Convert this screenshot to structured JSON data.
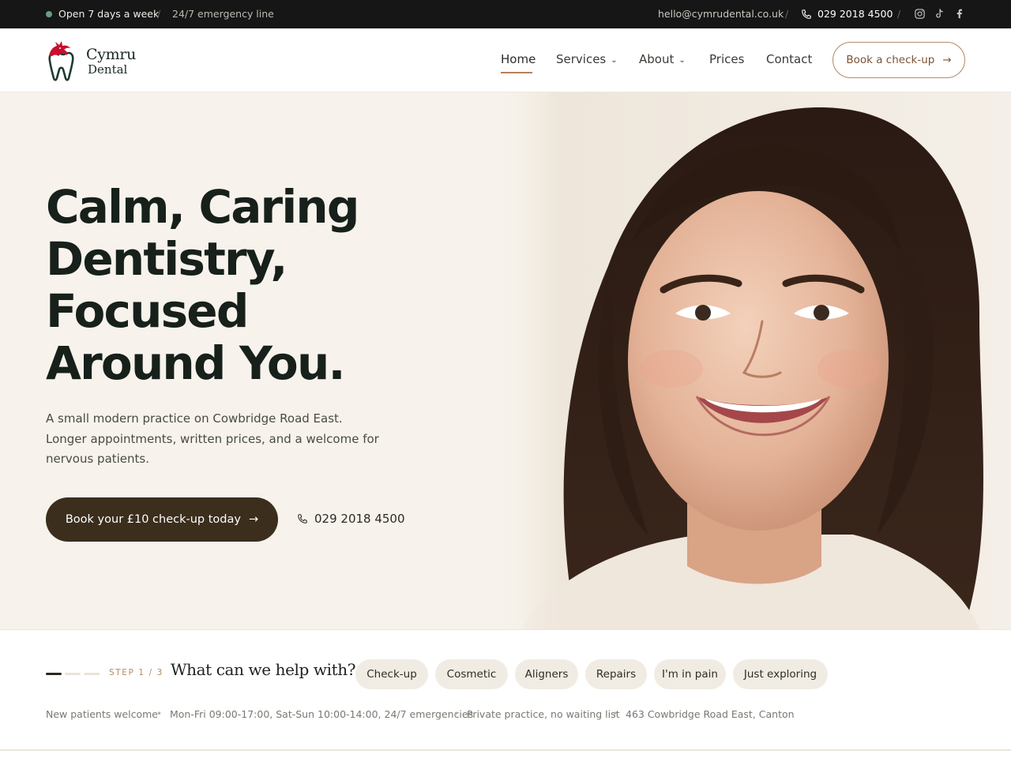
{
  "topbar": {
    "open_text": "Open 7 days a week",
    "emergency_text": "24/7 emergency line",
    "email": "hello@cymrudental.co.uk",
    "phone": "029 2018 4500",
    "separator": "/",
    "socials": [
      "instagram-icon",
      "tiktok-icon",
      "facebook-icon"
    ],
    "status_color": "#6c9c7e"
  },
  "header": {
    "logo_line1": "Cymru",
    "logo_line2": "Dental",
    "nav": [
      {
        "label": "Home",
        "active": true
      },
      {
        "label": "Services",
        "dropdown": true
      },
      {
        "label": "About",
        "dropdown": true
      },
      {
        "label": "Prices"
      },
      {
        "label": "Contact"
      }
    ],
    "book_label": "Book a check-up",
    "chevron": "⌄",
    "arrow": "→"
  },
  "hero": {
    "title_lines": [
      "Calm, Caring",
      "Dentistry,",
      "Focused",
      "Around You."
    ],
    "subtitle": "A small modern practice on Cowbridge Road East. Longer appointments, written prices, and a welcome for nervous patients.",
    "cta_label": "Book your £10 check-up today",
    "phone": "029 2018 4500",
    "cta_color": "#3b2e1c",
    "background_color": "#f7f3ec"
  },
  "helper": {
    "step_label": "STEP 1 / 3",
    "question": "What can we help with?",
    "options": [
      "Check-up",
      "Cosmetic",
      "Aligners",
      "Repairs",
      "I'm in pain",
      "Just exploring"
    ]
  },
  "info_bar": {
    "items": [
      "New patients welcome",
      "Mon-Fri 09:00-17:00, Sat-Sun 10:00-14:00, 24/7 emergencies",
      "Private practice, no waiting list",
      "463 Cowbridge Road East, Canton"
    ],
    "bullet": "•"
  },
  "colors": {
    "accent": "#b7805a",
    "dark": "#161616",
    "pill_bg": "#f1ece3"
  }
}
